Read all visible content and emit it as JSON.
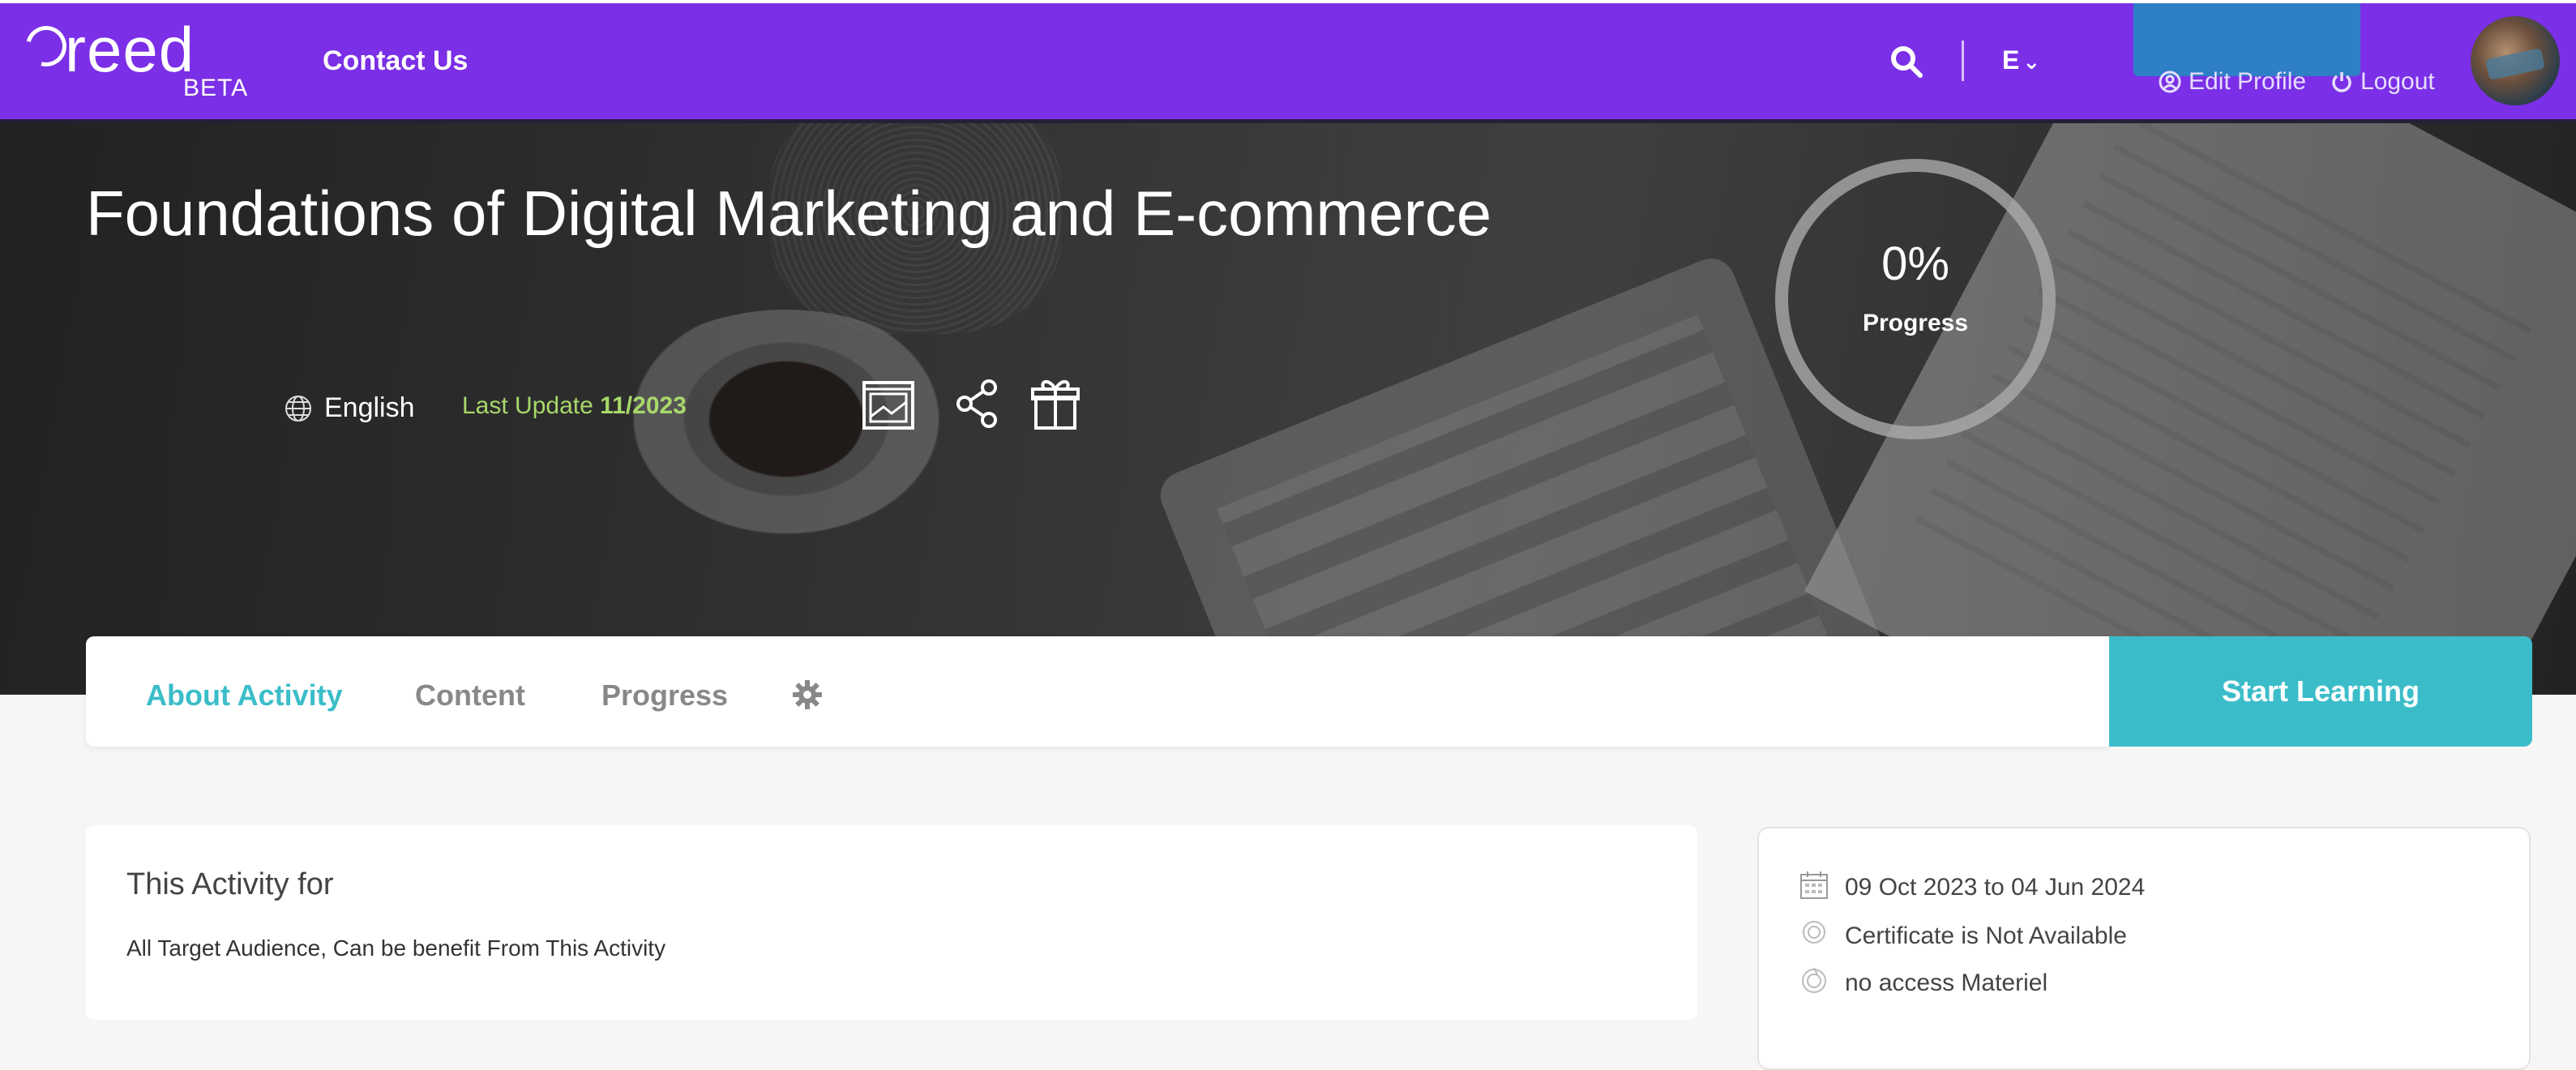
{
  "navbar": {
    "logo_word": "reed",
    "logo_badge": "BETA",
    "contact": "Contact Us",
    "lang": "E",
    "edit_profile": "Edit Profile",
    "logout": "Logout",
    "bg_color": "#7b2fe6"
  },
  "hero": {
    "title": "Foundations of Digital Marketing and E-commerce",
    "language": "English",
    "last_update_label": "Last Update",
    "last_update_value": "11/2023",
    "progress_value": "0%",
    "progress_label": "Progress",
    "progress_fraction": 0
  },
  "tabs": {
    "items": [
      {
        "label": "About Activity",
        "active": true
      },
      {
        "label": "Content",
        "active": false
      },
      {
        "label": "Progress",
        "active": false
      }
    ],
    "start_button": "Start Learning",
    "accent": "#3bbdc9"
  },
  "about": {
    "title": "This Activity for",
    "text": "All Target Audience, Can be benefit From This Activity"
  },
  "info": {
    "dates": "09 Oct 2023 to 04 Jun 2024",
    "certificate": "Certificate is Not Available",
    "material": "no access Materiel"
  },
  "icons": [
    "search-icon",
    "chevron-down-icon",
    "user-circle-icon",
    "power-icon",
    "globe-icon",
    "image-gallery-icon",
    "share-icon",
    "gift-icon",
    "gear-icon",
    "calendar-icon",
    "certificate-icon",
    "material-icon"
  ]
}
